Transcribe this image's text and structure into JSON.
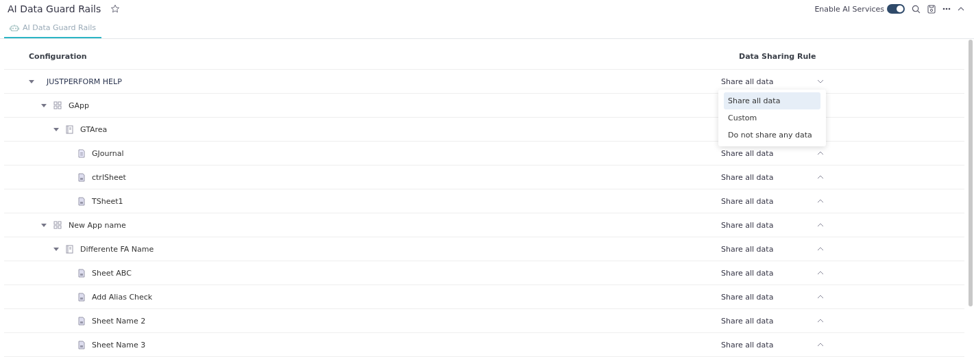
{
  "header": {
    "title": "AI Data Guard Rails",
    "favorite": false,
    "toggle_label": "Enable AI Services",
    "ai_enabled": true
  },
  "tabs": [
    {
      "label": "AI Data Guard Rails",
      "selected": true
    }
  ],
  "table": {
    "columns": [
      "Configuration",
      "Data Sharing Rule"
    ],
    "tree": [
      {
        "kind": "root",
        "name": "JUSTPERFORM HELP",
        "expanded": true,
        "rule": "Share all data",
        "open": true,
        "children": [
          {
            "kind": "app",
            "name": "GApp",
            "expanded": true,
            "children": [
              {
                "kind": "area",
                "name": "GTArea",
                "expanded": true,
                "children": [
                  {
                    "kind": "journal",
                    "name": "GJournal",
                    "rule": "Share all data",
                    "open": false
                  },
                  {
                    "kind": "sheet",
                    "name": "ctrlSheet",
                    "rule": "Share all data",
                    "open": false
                  },
                  {
                    "kind": "sheet",
                    "name": "TSheet1",
                    "rule": "Share all data",
                    "open": false
                  }
                ]
              }
            ]
          },
          {
            "kind": "app",
            "name": "New App name",
            "expanded": true,
            "rule": "Share all data",
            "open": false,
            "children": [
              {
                "kind": "area",
                "name": "Differente FA Name",
                "expanded": true,
                "rule": "Share all data",
                "open": false,
                "children": [
                  {
                    "kind": "sheet",
                    "name": "Sheet ABC",
                    "rule": "Share all data",
                    "open": false
                  },
                  {
                    "kind": "sheet",
                    "name": "Add Alias Check",
                    "rule": "Share all data",
                    "open": false
                  },
                  {
                    "kind": "sheet",
                    "name": "Sheet Name 2",
                    "rule": "Share all data",
                    "open": false
                  },
                  {
                    "kind": "sheet",
                    "name": "Sheet Name 3",
                    "rule": "Share all data",
                    "open": false
                  }
                ]
              }
            ]
          }
        ]
      }
    ],
    "dropdown": [
      {
        "label": "Share all data",
        "selected": true
      },
      {
        "label": "Custom",
        "selected": false
      },
      {
        "label": "Do not share any data",
        "selected": false
      }
    ]
  }
}
